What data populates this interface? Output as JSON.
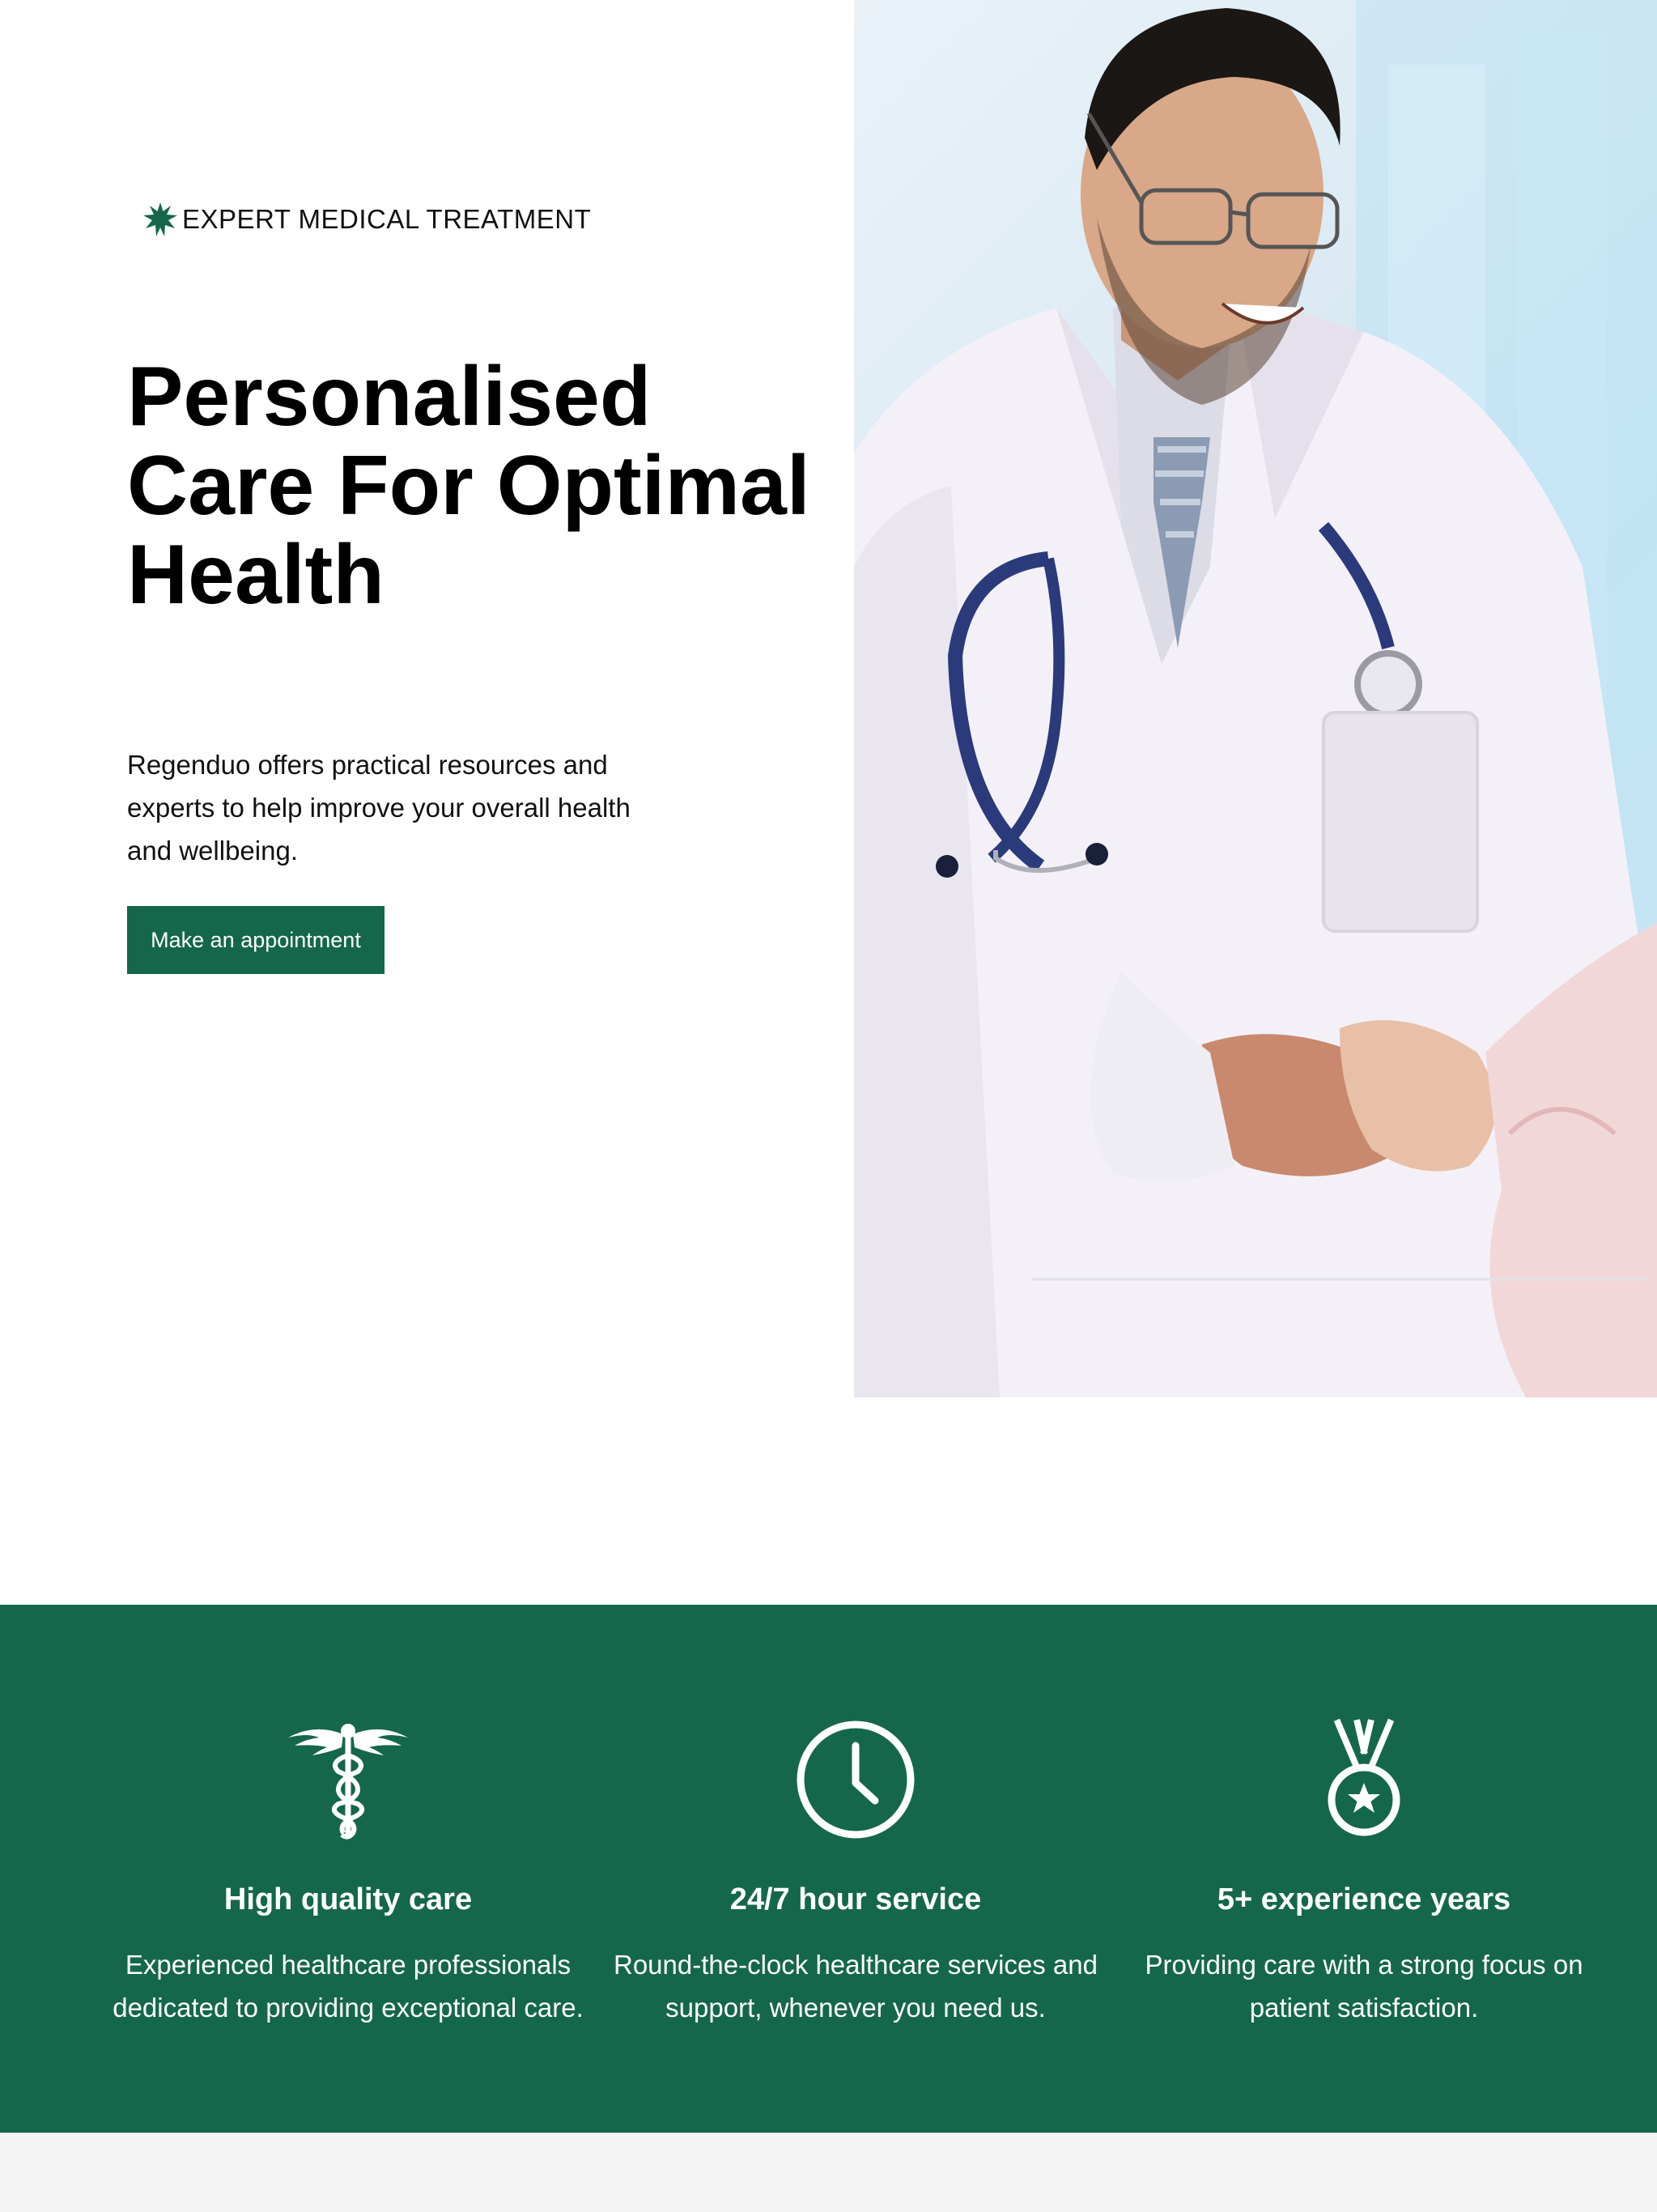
{
  "hero": {
    "eyebrow": "EXPERT MEDICAL TREATMENT",
    "title": "Personalised Care For Optimal Health",
    "description": "Regenduo offers practical resources and experts to help improve your overall health and wellbeing.",
    "cta_label": "Make an appointment",
    "image_alt": "doctor-holding-patient-hands-photo"
  },
  "features": [
    {
      "icon": "caduceus-icon",
      "title": "High quality care",
      "description": "Experienced healthcare professionals dedicated to providing exceptional care."
    },
    {
      "icon": "clock-icon",
      "title": "24/7 hour service",
      "description": "Round-the-clock healthcare services and support, whenever you need us."
    },
    {
      "icon": "medal-icon",
      "title": "5+ experience years",
      "description": "Providing care with a strong focus on patient satisfaction."
    }
  ],
  "colors": {
    "brand_green": "#14674b",
    "text": "#000000",
    "footer_bg": "#f4f4f4"
  }
}
